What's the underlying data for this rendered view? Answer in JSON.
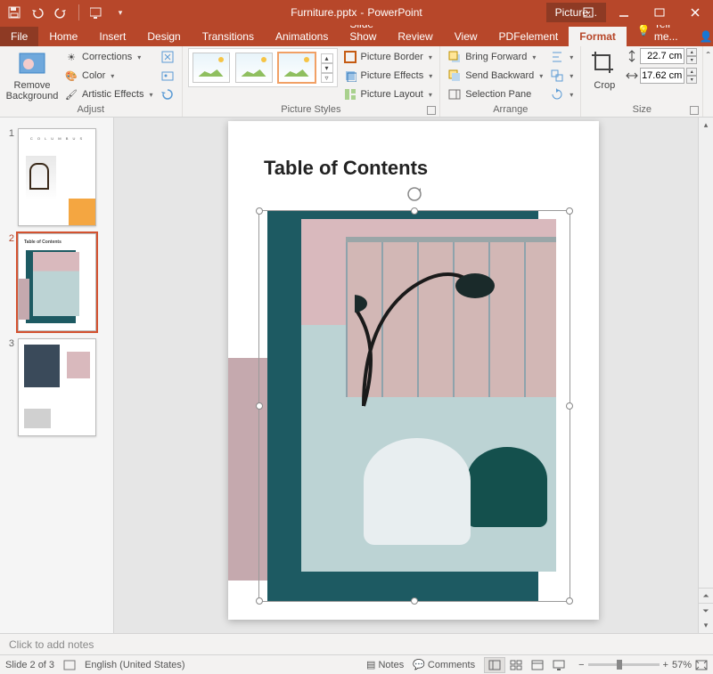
{
  "titlebar": {
    "filename": "Furniture.pptx",
    "app": "PowerPoint",
    "context_tab": "Picture..."
  },
  "tabs": {
    "file": "File",
    "home": "Home",
    "insert": "Insert",
    "design": "Design",
    "transitions": "Transitions",
    "animations": "Animations",
    "slideshow": "Slide Show",
    "review": "Review",
    "view": "View",
    "pdfelement": "PDFelement",
    "format": "Format",
    "tellme": "Tell me...",
    "share": "Share"
  },
  "ribbon": {
    "remove_bg": "Remove Background",
    "corrections": "Corrections",
    "color": "Color",
    "artistic": "Artistic Effects",
    "adjust_label": "Adjust",
    "styles_label": "Picture Styles",
    "border": "Picture Border",
    "effects": "Picture Effects",
    "layout": "Picture Layout",
    "bring_forward": "Bring Forward",
    "send_backward": "Send Backward",
    "selection_pane": "Selection Pane",
    "arrange_label": "Arrange",
    "crop": "Crop",
    "height_value": "22.7 cm",
    "width_value": "17.62 cm",
    "size_label": "Size"
  },
  "slides": {
    "s1": "1",
    "s2": "2",
    "s3": "3",
    "toc_title": "Table of Contents"
  },
  "notes_placeholder": "Click to add notes",
  "status": {
    "slide_of": "Slide 2 of 3",
    "language": "English (United States)",
    "notes": "Notes",
    "comments": "Comments",
    "zoom_pct": "57%"
  }
}
